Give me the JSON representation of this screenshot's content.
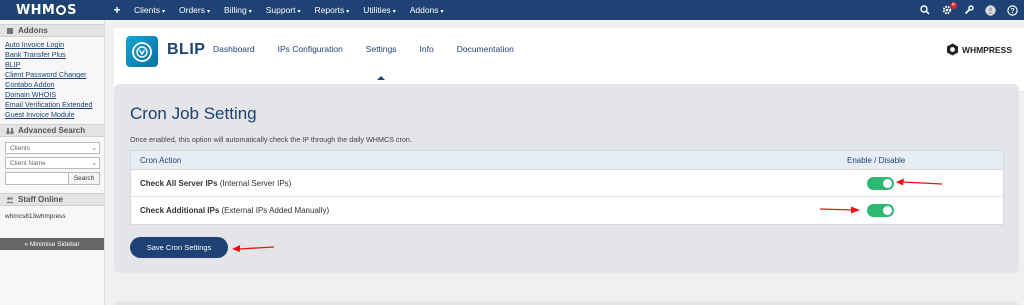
{
  "nav": {
    "logo_pre": "WHM",
    "logo_post": "S",
    "plus": "+",
    "menu": [
      {
        "label": "Clients"
      },
      {
        "label": "Orders"
      },
      {
        "label": "Billing"
      },
      {
        "label": "Support"
      },
      {
        "label": "Reports"
      },
      {
        "label": "Utilities"
      },
      {
        "label": "Addons"
      }
    ],
    "caret": "▾",
    "badge": "✕",
    "icons": [
      "search-icon",
      "gear-icon",
      "wrench-icon",
      "user-icon",
      "help-icon"
    ]
  },
  "sidebar": {
    "addons_title": "Addons",
    "addons": [
      "Auto Invoice Login",
      "Bank Transfer Plus",
      "BLIP",
      "Client Password Changer",
      "Contabo Addon",
      "Domain WHOIS",
      "Email Verification Extended",
      "Guest Invoice Module"
    ],
    "advanced_search_title": "Advanced Search",
    "search_type": "Clients",
    "search_field": "Client Name",
    "search_button": "Search",
    "staff_title": "Staff Online",
    "staff_name": "whmcs813whmpress",
    "minimise": "« Minimise Sidebar",
    "select_caret": "⌄"
  },
  "addon": {
    "title": "BLIP",
    "tabs": [
      "Dashboard",
      "IPs Configuration",
      "Settings",
      "Info",
      "Documentation"
    ],
    "active_tab": "Settings",
    "brand": "WHMPRESS",
    "accent": "#1d4273",
    "toggle_color": "#2eb872"
  },
  "cron": {
    "title": "Cron Job Setting",
    "description": "Once enabled, this option will automatically check the IP through the daily WHMCS cron.",
    "col_action": "Cron Action",
    "col_toggle": "Enable / Disable",
    "rows": [
      {
        "name": "Check All Server IPs",
        "detail": "(Internal Server IPs)",
        "enabled": true
      },
      {
        "name": "Check Additional IPs",
        "detail": "(External IPs Added Manually)",
        "enabled": true
      }
    ],
    "save_label": "Save Cron Settings"
  }
}
